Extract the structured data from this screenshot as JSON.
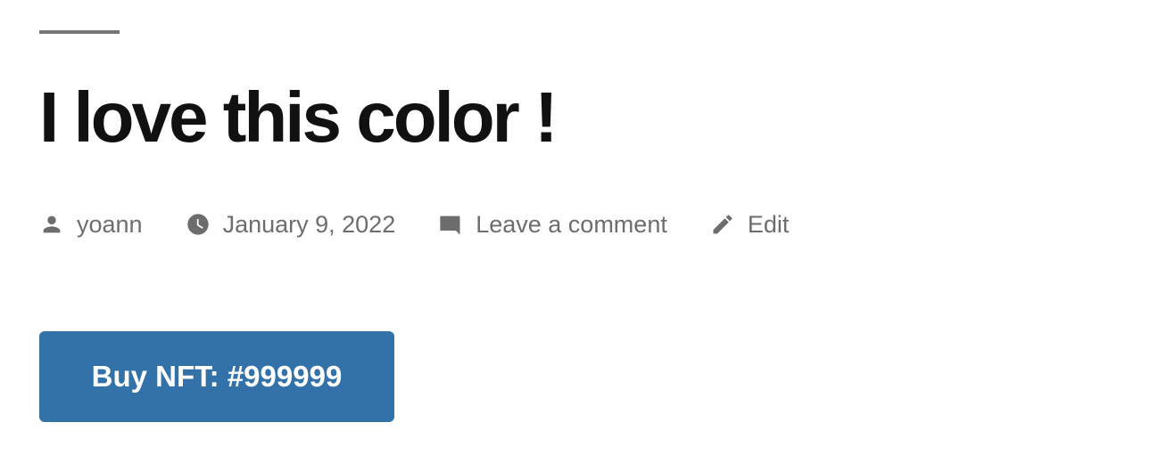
{
  "post": {
    "title": "I love this color !",
    "meta": {
      "author": "yoann",
      "date": "January 9, 2022",
      "comment_link": "Leave a comment",
      "edit_link": "Edit"
    },
    "buy_button": "Buy NFT: #999999"
  },
  "icons": {
    "author": "user-icon",
    "date": "clock-icon",
    "comment": "comment-icon",
    "edit": "pencil-icon"
  },
  "colors": {
    "title_text": "#111111",
    "meta_text": "#6d6d6d",
    "divider": "#767676",
    "button_bg": "#3272a8",
    "button_text": "#ffffff"
  }
}
